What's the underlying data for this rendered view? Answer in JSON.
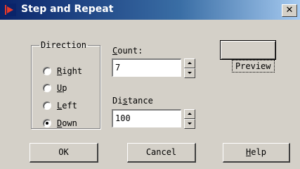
{
  "window": {
    "title": "Step and Repeat",
    "close_glyph": "✕"
  },
  "direction": {
    "legend": "Direction",
    "options": [
      {
        "pre": "",
        "mnemonic": "R",
        "post": "ight",
        "checked": false
      },
      {
        "pre": "",
        "mnemonic": "U",
        "post": "p",
        "checked": false
      },
      {
        "pre": "",
        "mnemonic": "L",
        "post": "eft",
        "checked": false
      },
      {
        "pre": "",
        "mnemonic": "D",
        "post": "own",
        "checked": true
      }
    ]
  },
  "count": {
    "label_pre": "",
    "label_mnemonic": "C",
    "label_post": "ount:",
    "value": "7"
  },
  "distance": {
    "label_pre": "Di",
    "label_mnemonic": "s",
    "label_post": "tance",
    "value": "100"
  },
  "buttons": {
    "preview": "Preview",
    "ok": "OK",
    "cancel": "Cancel",
    "help_mnemonic": "H",
    "help_post": "elp"
  },
  "colors": {
    "titlebar_start": "#0a246a",
    "titlebar_end": "#a6caf0",
    "face": "#d4d0c8",
    "icon": "#e83a2a"
  }
}
